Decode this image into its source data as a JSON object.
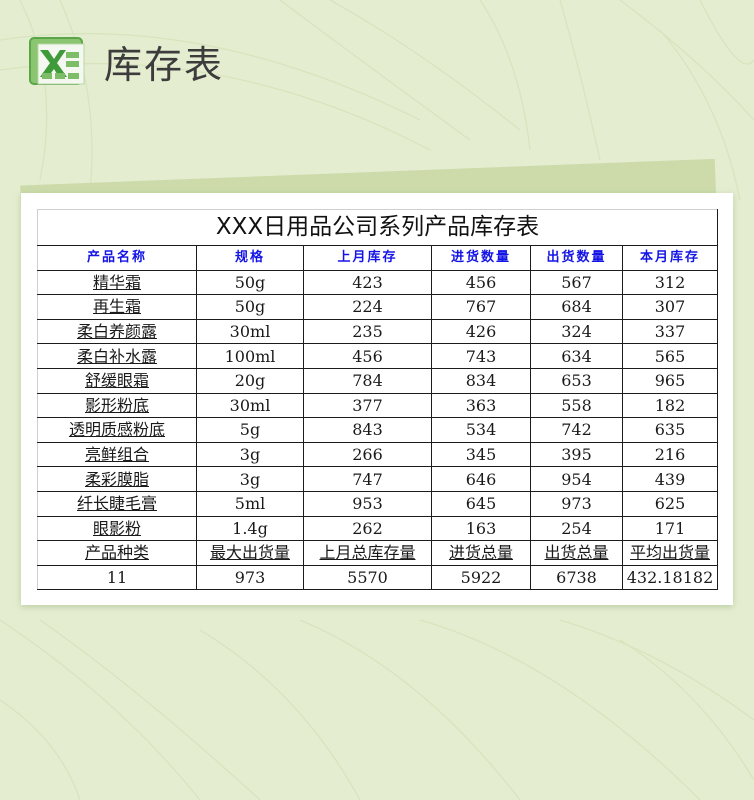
{
  "header": {
    "app_icon": "excel-icon",
    "title": "库存表"
  },
  "sheet": {
    "title": "XXX日用品公司系列产品库存表",
    "columns": [
      "产品名称",
      "规格",
      "上月库存",
      "进货数量",
      "出货数量",
      "本月库存"
    ],
    "rows": [
      [
        "精华霜",
        "50g",
        "423",
        "456",
        "567",
        "312"
      ],
      [
        "再生霜",
        "50g",
        "224",
        "767",
        "684",
        "307"
      ],
      [
        "柔白养颜露",
        "30ml",
        "235",
        "426",
        "324",
        "337"
      ],
      [
        "柔白补水露",
        "100ml",
        "456",
        "743",
        "634",
        "565"
      ],
      [
        "舒缓眼霜",
        "20g",
        "784",
        "834",
        "653",
        "965"
      ],
      [
        "影形粉底",
        "30ml",
        "377",
        "363",
        "558",
        "182"
      ],
      [
        "透明质感粉底",
        "5g",
        "843",
        "534",
        "742",
        "635"
      ],
      [
        "亮鲜组合",
        "3g",
        "266",
        "345",
        "395",
        "216"
      ],
      [
        "柔彩膜脂",
        "3g",
        "747",
        "646",
        "954",
        "439"
      ],
      [
        "纤长睫毛膏",
        "5ml",
        "953",
        "645",
        "973",
        "625"
      ],
      [
        "眼影粉",
        "1.4g",
        "262",
        "163",
        "254",
        "171"
      ]
    ],
    "summary_labels": [
      "产品种类",
      "最大出货量",
      "上月总库存量",
      "进货总量",
      "出货总量",
      "平均出货量"
    ],
    "summary_values": [
      "11",
      "973",
      "5570",
      "5922",
      "6738",
      "432.18182"
    ]
  },
  "colors": {
    "background": "#e4edd0",
    "back_card": "#cddbab",
    "header_text": "#1414e6",
    "excel_green": "#3f9a3a"
  }
}
